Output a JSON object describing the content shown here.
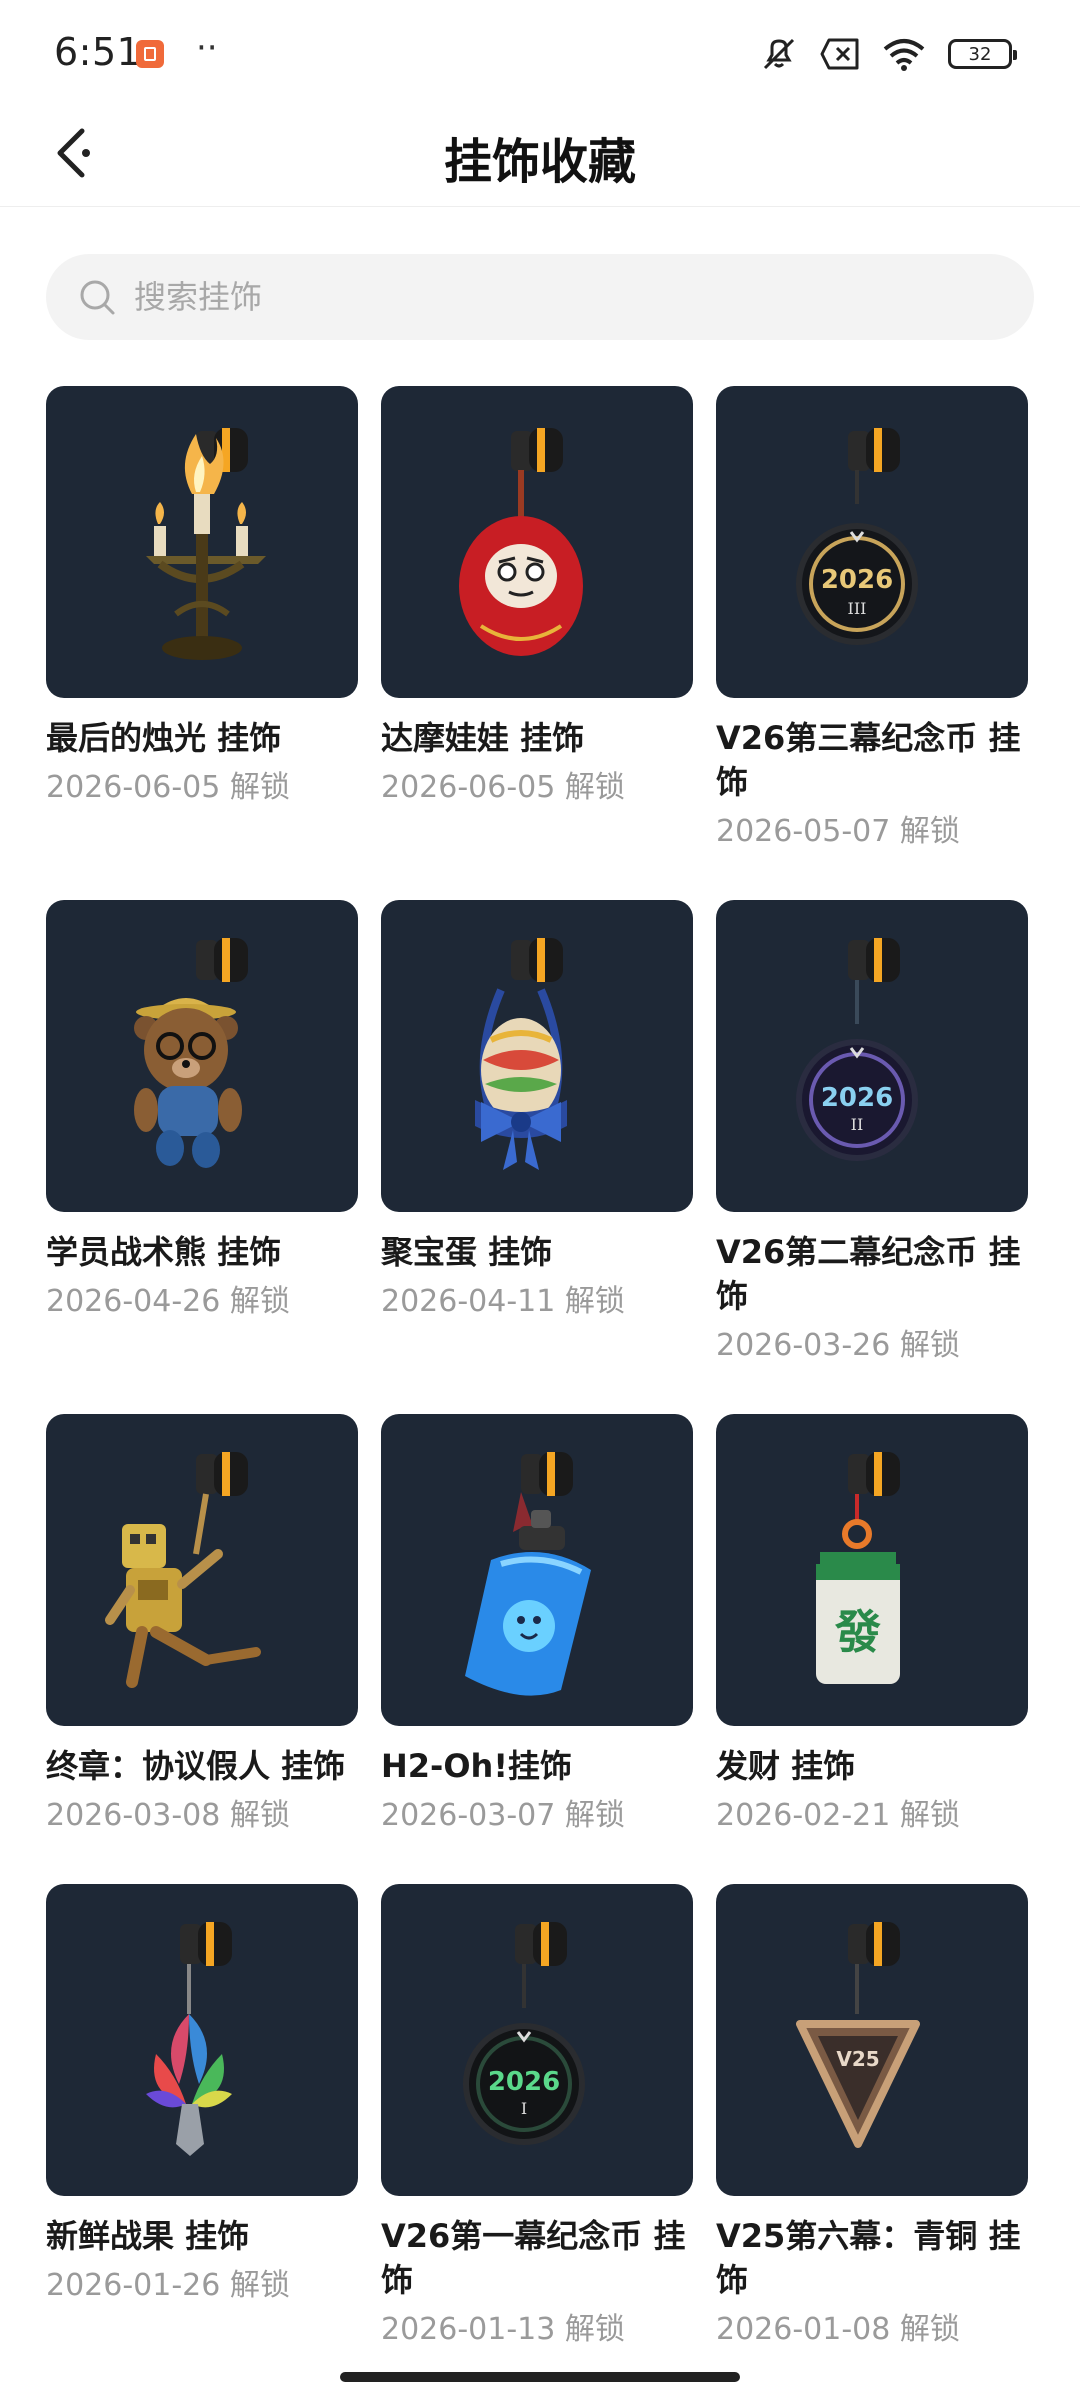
{
  "status": {
    "time": "6:51",
    "dots": "··",
    "battery": "32"
  },
  "header": {
    "title": "挂饰收藏"
  },
  "search": {
    "placeholder": "搜索挂饰"
  },
  "items": [
    {
      "name": "最后的烛光 挂饰",
      "date": "2026-06-05 解锁",
      "icon": "candelabra-charm"
    },
    {
      "name": "达摩娃娃 挂饰",
      "date": "2026-06-05 解锁",
      "icon": "daruma-doll-charm"
    },
    {
      "name": "V26第三幕纪念币 挂饰",
      "date": "2026-05-07 解锁",
      "icon": "coin-2026-III-charm"
    },
    {
      "name": "学员战术熊 挂饰",
      "date": "2026-04-26 解锁",
      "icon": "teddy-bear-charm"
    },
    {
      "name": "聚宝蛋 挂饰",
      "date": "2026-04-11 解锁",
      "icon": "egg-bow-charm"
    },
    {
      "name": "V26第二幕纪念币 挂饰",
      "date": "2026-03-26 解锁",
      "icon": "coin-2026-II-charm"
    },
    {
      "name": "终章：协议假人 挂饰",
      "date": "2026-03-08 解锁",
      "icon": "golden-robot-charm"
    },
    {
      "name": "H2-Oh!挂饰",
      "date": "2026-03-07 解锁",
      "icon": "water-bottle-charm"
    },
    {
      "name": "发财 挂饰",
      "date": "2026-02-21 解锁",
      "icon": "mahjong-tile-charm"
    },
    {
      "name": "新鲜战果 挂饰",
      "date": "2026-01-26 解锁",
      "icon": "leaf-flower-charm"
    },
    {
      "name": "V26第一幕纪念币 挂饰",
      "date": "2026-01-13 解锁",
      "icon": "coin-2026-I-charm"
    },
    {
      "name": "V25第六幕：青铜 挂饰",
      "date": "2026-01-08 解锁",
      "icon": "bronze-triangle-charm"
    }
  ],
  "coins": {
    "c3": {
      "year": "2026",
      "act": "III"
    },
    "c6": {
      "year": "2026",
      "act": "II"
    },
    "c11": {
      "year": "2026",
      "act": "I"
    }
  },
  "tile": {
    "glyph": "發"
  },
  "badge": {
    "label": "V25"
  },
  "colors": {
    "thumb_bg": "#1e2836",
    "date_text": "#9a9a9a",
    "search_bg": "#f3f3f3",
    "strap_orange": "#f5a623"
  }
}
